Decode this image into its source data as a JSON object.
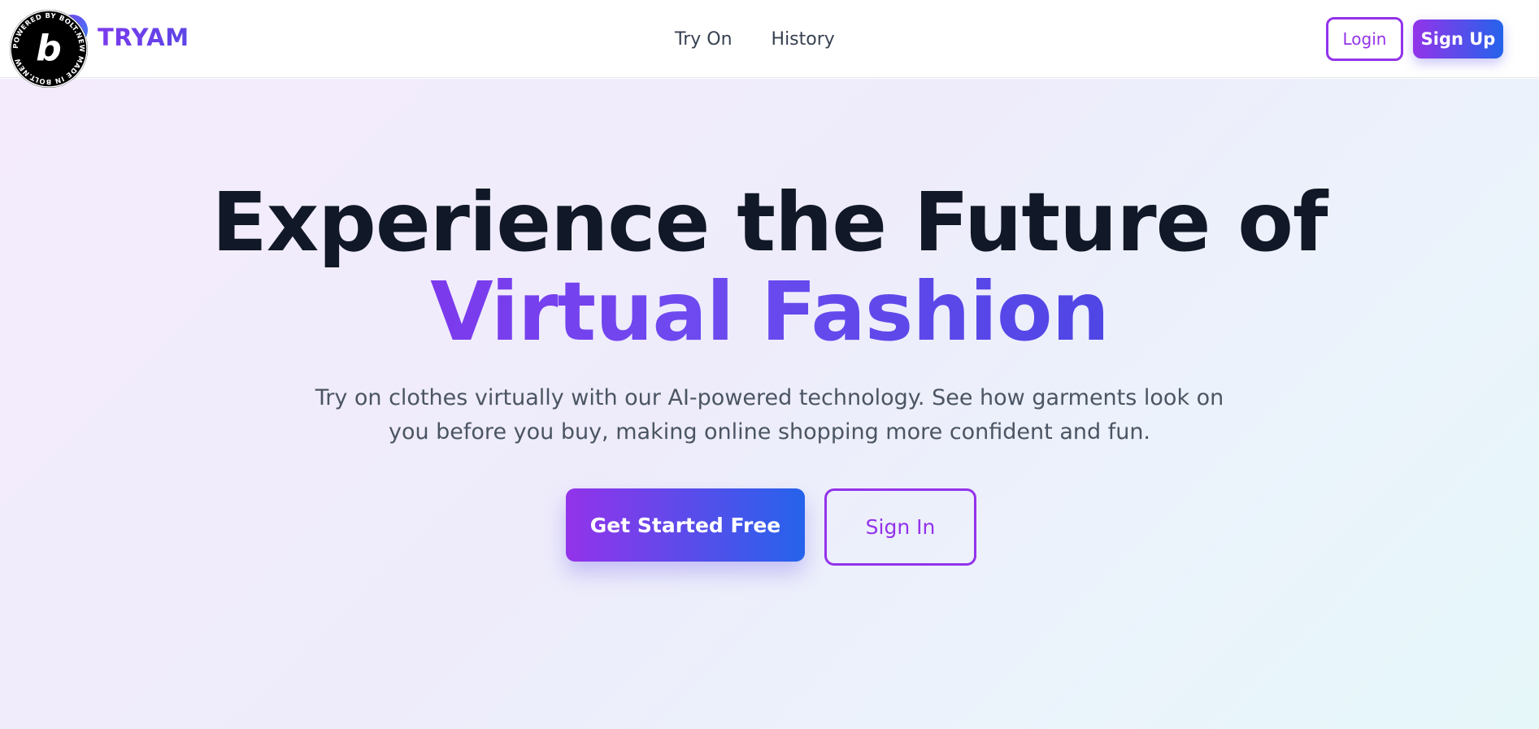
{
  "brand": {
    "name": "TRYAM"
  },
  "nav": {
    "items": [
      {
        "label": "Try On"
      },
      {
        "label": "History"
      }
    ]
  },
  "auth": {
    "login_label": "Login",
    "signup_label": "Sign Up"
  },
  "badge": {
    "text": "POWERED BY BOLT.NEW MADE IN BOLT.NEW ",
    "letter": "b"
  },
  "hero": {
    "headline_line1": "Experience the Future of",
    "headline_line2": "Virtual Fashion",
    "subtitle": "Try on clothes virtually with our AI-powered technology. See how garments look on you before you buy, making online shopping more confident and fun.",
    "primary_cta": "Get Started Free",
    "secondary_cta": "Sign In"
  },
  "colors": {
    "accent_purple": "#9333ea",
    "accent_blue": "#2563eb",
    "headline_dark": "#111827"
  }
}
